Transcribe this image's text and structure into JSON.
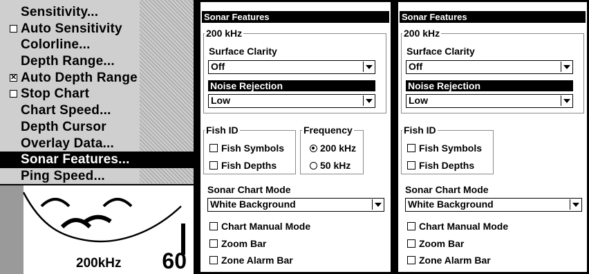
{
  "menu": {
    "items": [
      {
        "label": "Sensitivity...",
        "checkbox": false,
        "checked": false
      },
      {
        "label": "Auto Sensitivity",
        "checkbox": true,
        "checked": false
      },
      {
        "label": "Colorline...",
        "checkbox": false,
        "checked": false
      },
      {
        "label": "Depth Range...",
        "checkbox": false,
        "checked": false
      },
      {
        "label": "Auto Depth Range",
        "checkbox": true,
        "checked": true
      },
      {
        "label": "Stop Chart",
        "checkbox": true,
        "checked": false
      },
      {
        "label": "Chart Speed...",
        "checkbox": false,
        "checked": false
      },
      {
        "label": "Depth Cursor",
        "checkbox": false,
        "checked": false
      },
      {
        "label": "Overlay Data...",
        "checkbox": false,
        "checked": false
      },
      {
        "label": "Sonar Features...",
        "checkbox": false,
        "checked": false,
        "highlighted": true
      },
      {
        "label": "Ping Speed...",
        "checkbox": false,
        "checked": false
      }
    ]
  },
  "sonar": {
    "frequency": "200kHz",
    "depth": "60"
  },
  "dialog_left": {
    "title": "Sonar Features",
    "group_200": "200 kHz",
    "surface_clarity_label": "Surface Clarity",
    "surface_clarity_value": "Off",
    "noise_rejection_label": "Noise Rejection",
    "noise_rejection_value": "Low",
    "fish_id_label": "Fish ID",
    "fish_symbols": "Fish Symbols",
    "fish_depths": "Fish Depths",
    "frequency_label": "Frequency",
    "freq_200": "200 kHz",
    "freq_50": "50 kHz",
    "chart_mode_label": "Sonar Chart Mode",
    "chart_mode_value": "White Background",
    "chart_manual": "Chart Manual Mode",
    "zoom_bar": "Zoom Bar",
    "zone_alarm_bar": "Zone Alarm Bar"
  },
  "dialog_right": {
    "title": "Sonar Features",
    "group_200": "200 kHz",
    "surface_clarity_label": "Surface Clarity",
    "surface_clarity_value": "Off",
    "noise_rejection_label": "Noise Rejection",
    "noise_rejection_value": "Low",
    "fish_id_label": "Fish ID",
    "fish_symbols": "Fish Symbols",
    "fish_depths": "Fish Depths",
    "chart_mode_label": "Sonar Chart Mode",
    "chart_mode_value": "White Background",
    "chart_manual": "Chart Manual Mode",
    "zoom_bar": "Zoom Bar",
    "zone_alarm_bar": "Zone Alarm Bar"
  }
}
